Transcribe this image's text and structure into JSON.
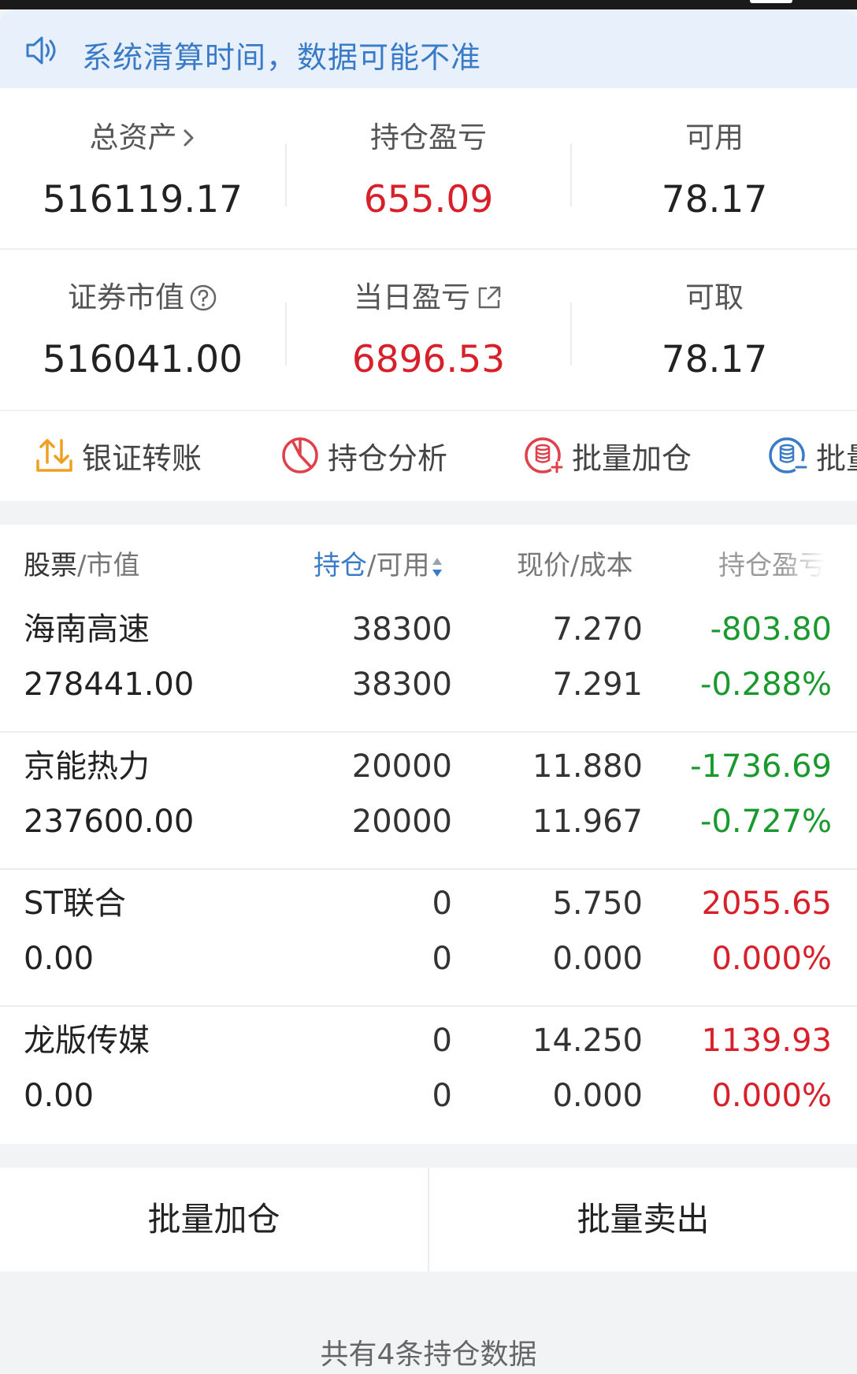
{
  "notice": {
    "text": "系统清算时间，数据可能不准"
  },
  "summary": {
    "total_assets": {
      "label": "总资产",
      "value": "516119.17"
    },
    "position_pnl": {
      "label": "持仓盈亏",
      "value": "655.09"
    },
    "available": {
      "label": "可用",
      "value": "78.17"
    },
    "market_value": {
      "label": "证券市值",
      "value": "516041.00"
    },
    "daily_pnl": {
      "label": "当日盈亏",
      "value": "6896.53"
    },
    "withdrawable": {
      "label": "可取",
      "value": "78.17"
    }
  },
  "actions": [
    {
      "label": "银证转账",
      "icon": "transfer-icon"
    },
    {
      "label": "持仓分析",
      "icon": "pie-chart-icon"
    },
    {
      "label": "批量加仓",
      "icon": "batch-add-icon"
    },
    {
      "label": "批量",
      "icon": "batch-sell-icon"
    }
  ],
  "table": {
    "headers": {
      "stock": "股票",
      "market_value": "/市值",
      "holding": "持仓",
      "available": "/可用",
      "price_cost": "现价/成本",
      "pnl": "持仓盈亏"
    },
    "rows": [
      {
        "name": "海南高速",
        "market_value": "278441.00",
        "holding": "38300",
        "available": "38300",
        "price": "7.270",
        "cost": "7.291",
        "pnl": "-803.80",
        "pnl_pct": "-0.288%",
        "direction": "down"
      },
      {
        "name": "京能热力",
        "market_value": "237600.00",
        "holding": "20000",
        "available": "20000",
        "price": "11.880",
        "cost": "11.967",
        "pnl": "-1736.69",
        "pnl_pct": "-0.727%",
        "direction": "down"
      },
      {
        "name": "ST联合",
        "market_value": "0.00",
        "holding": "0",
        "available": "0",
        "price": "5.750",
        "cost": "0.000",
        "pnl": "2055.65",
        "pnl_pct": "0.000%",
        "direction": "up"
      },
      {
        "name": "龙版传媒",
        "market_value": "0.00",
        "holding": "0",
        "available": "0",
        "price": "14.250",
        "cost": "0.000",
        "pnl": "1139.93",
        "pnl_pct": "0.000%",
        "direction": "up"
      }
    ]
  },
  "batch": {
    "add_label": "批量加仓",
    "sell_label": "批量卖出"
  },
  "footer": {
    "count_text": "共有4条持仓数据"
  },
  "colors": {
    "up": "#d8202a",
    "down": "#1a9a2e",
    "accent": "#3a7bc8"
  }
}
